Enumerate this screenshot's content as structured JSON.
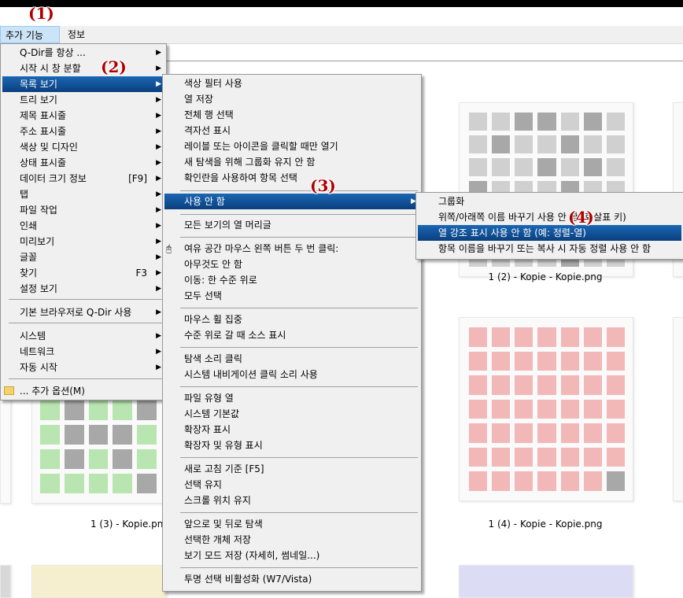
{
  "menubar": {
    "items": [
      "추가 기능(X)",
      "정보"
    ]
  },
  "annotations": [
    "(1)",
    "(2)",
    "(3)",
    "(4)"
  ],
  "main_menu": [
    {
      "label": "Q-Dir를 항상 ...",
      "shortcut": "",
      "arrow": "▶"
    },
    {
      "label": "시작 시 창 분할",
      "shortcut": "",
      "arrow": "▶"
    },
    {
      "label": "목록 보기",
      "shortcut": "",
      "arrow": "▶"
    },
    {
      "label": "트리 보기",
      "shortcut": "",
      "arrow": "▶"
    },
    {
      "label": "제목 표시줄",
      "shortcut": "",
      "arrow": "▶"
    },
    {
      "label": "주소 표시줄",
      "shortcut": "",
      "arrow": "▶"
    },
    {
      "label": "색상 및 디자인",
      "shortcut": "",
      "arrow": "▶"
    },
    {
      "label": "상태 표시줄",
      "shortcut": "",
      "arrow": "▶"
    },
    {
      "label": "데이터 크기 정보",
      "shortcut": "[F9]",
      "arrow": "▶"
    },
    {
      "label": "탭",
      "shortcut": "",
      "arrow": "▶"
    },
    {
      "label": "파일 작업",
      "shortcut": "",
      "arrow": "▶"
    },
    {
      "label": "인쇄",
      "shortcut": "",
      "arrow": "▶"
    },
    {
      "label": "미리보기",
      "shortcut": "",
      "arrow": "▶"
    },
    {
      "label": "글꼴",
      "shortcut": "",
      "arrow": "▶"
    },
    {
      "label": "찾기",
      "shortcut": "F3",
      "arrow": "▶"
    },
    {
      "label": "설정 보기",
      "shortcut": "",
      "arrow": "▶"
    },
    {
      "label": "기본 브라우저로 Q-Dir 사용",
      "shortcut": "",
      "arrow": "▶"
    },
    {
      "label": "시스템",
      "shortcut": "",
      "arrow": "▶"
    },
    {
      "label": "네트워크",
      "shortcut": "",
      "arrow": "▶"
    },
    {
      "label": "자동 시작",
      "shortcut": "",
      "arrow": "▶"
    },
    {
      "label": "... 추가 옵션(M)",
      "shortcut": "",
      "arrow": ""
    }
  ],
  "list_view_menu": [
    {
      "label": "색상 필터 사용",
      "arrow": ""
    },
    {
      "label": "열 저장",
      "arrow": ""
    },
    {
      "label": "전체 행 선택",
      "arrow": ""
    },
    {
      "label": "격자선 표시",
      "arrow": ""
    },
    {
      "label": "레이블 또는 아이콘을 클릭할 때만 열기",
      "arrow": ""
    },
    {
      "label": "새 탐색을 위해 그룹화 유지 안 함",
      "arrow": ""
    },
    {
      "label": "확인란을 사용하여 항목 선택",
      "arrow": ""
    },
    {
      "label": "사용 안 함",
      "arrow": "▶"
    },
    {
      "label": "모든 보기의 열 머리글",
      "arrow": ""
    },
    {
      "label": "여유 공간 마우스 왼쪽 버튼 두 번 클릭:",
      "arrow": ""
    },
    {
      "label": "아무것도 안 함",
      "arrow": ""
    },
    {
      "label": "이동: 한 수준 위로",
      "arrow": ""
    },
    {
      "label": "모두 선택",
      "arrow": ""
    },
    {
      "label": "마우스 휠 집중",
      "arrow": ""
    },
    {
      "label": "수준 위로 갈 때 소스 표시",
      "arrow": ""
    },
    {
      "label": "탐색 소리 클릭",
      "arrow": ""
    },
    {
      "label": "시스템 내비게이션 클릭 소리 사용",
      "arrow": ""
    },
    {
      "label": "파일 유형 열",
      "arrow": ""
    },
    {
      "label": "시스템 기본값",
      "arrow": ""
    },
    {
      "label": "확장자 표시",
      "arrow": ""
    },
    {
      "label": "확장자 및 유형 표시",
      "arrow": ""
    },
    {
      "label": "새로 고침 기준 [F5]",
      "arrow": ""
    },
    {
      "label": "선택 유지",
      "arrow": ""
    },
    {
      "label": "스크롤 위치 유지",
      "arrow": ""
    },
    {
      "label": "앞으로 및 뒤로 탐색",
      "arrow": ""
    },
    {
      "label": "선택한 개체 저장",
      "arrow": ""
    },
    {
      "label": "보기 모드 저장 (자세히, 썸네일...)",
      "arrow": ""
    },
    {
      "label": "투명 선택 비활성화 (W7/Vista)",
      "arrow": ""
    }
  ],
  "disable_menu": [
    {
      "label": "그룹화"
    },
    {
      "label": "위쪽/아래쪽 이름 바꾸기 사용 안 함 (화살표 키)"
    },
    {
      "label": "열 강조 표시 사용 안 함 (예: 정렬-열)"
    },
    {
      "label": "항목 이름을 바꾸기 또는 복사 시 자동 정렬 사용 안 함"
    }
  ],
  "captions": [
    "1 (2) - Kopie - Kopie.png",
    "1 (3) - Kopie.png",
    "1 (4) - Kopie - Kopie.png"
  ],
  "colors": {
    "highlight": "#0b4a8e",
    "annotation": "#b00000",
    "red_tile": "#f2b8b8",
    "green_tile": "#b9e5b0",
    "gray_tile": "#d0d0d0"
  }
}
